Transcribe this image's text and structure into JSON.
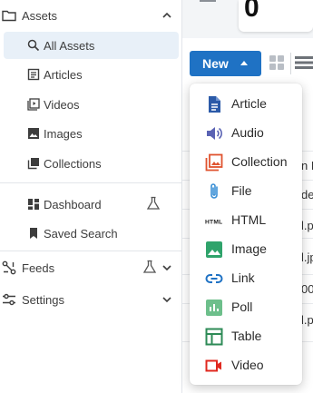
{
  "sidebar": {
    "assets": {
      "label": "Assets",
      "items": [
        {
          "label": "All Assets",
          "icon": "search-icon"
        },
        {
          "label": "Articles",
          "icon": "article-icon"
        },
        {
          "label": "Videos",
          "icon": "video-icon"
        },
        {
          "label": "Images",
          "icon": "image-icon"
        },
        {
          "label": "Collections",
          "icon": "collections-icon"
        }
      ]
    },
    "dashboard": {
      "label": "Dashboard",
      "icon": "dashboard-icon"
    },
    "saved_search": {
      "label": "Saved Search",
      "icon": "bookmark-icon"
    },
    "feeds": {
      "label": "Feeds",
      "icon": "feeds-icon"
    },
    "settings": {
      "label": "Settings",
      "icon": "settings-icon"
    }
  },
  "main": {
    "stat_value": "0",
    "new_button": "New",
    "peek_texts": [
      "n E",
      "de",
      "l.p",
      "l.jp",
      "00",
      "l.p"
    ]
  },
  "menu": {
    "items": [
      {
        "label": "Article",
        "icon": "article-icon",
        "color": "#2b5aa8"
      },
      {
        "label": "Audio",
        "icon": "audio-icon",
        "color": "#5a63b4"
      },
      {
        "label": "Collection",
        "icon": "collection-icon",
        "color": "#e0532f"
      },
      {
        "label": "File",
        "icon": "paperclip-icon",
        "color": "#3a8fd6"
      },
      {
        "label": "HTML",
        "icon": "html-icon",
        "color": "#222222"
      },
      {
        "label": "Image",
        "icon": "image-icon",
        "color": "#2fa36b"
      },
      {
        "label": "Link",
        "icon": "link-icon",
        "color": "#1f72c4"
      },
      {
        "label": "Poll",
        "icon": "poll-icon",
        "color": "#6dbf8b"
      },
      {
        "label": "Table",
        "icon": "table-icon",
        "color": "#2e8b57"
      },
      {
        "label": "Video",
        "icon": "video-icon",
        "color": "#e0281f"
      }
    ]
  },
  "colors": {
    "accent": "#1f72c4",
    "active_bg": "#e8f0f8"
  }
}
